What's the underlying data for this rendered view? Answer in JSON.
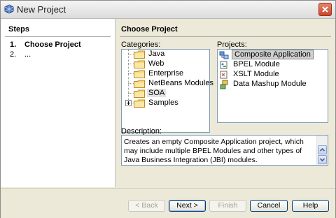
{
  "window": {
    "title": "New Project"
  },
  "steps": {
    "heading": "Steps",
    "items": [
      {
        "num": "1.",
        "label": "Choose Project"
      },
      {
        "num": "2.",
        "label": "..."
      }
    ]
  },
  "panel": {
    "heading": "Choose Project",
    "categories_label": "Categories:",
    "projects_label": "Projects:",
    "categories": [
      "Java",
      "Web",
      "Enterprise",
      "NetBeans Modules",
      "SOA",
      "Samples"
    ],
    "selected_category": "SOA",
    "projects": [
      {
        "label": "Composite Application",
        "icon": "composite-app-icon"
      },
      {
        "label": "BPEL Module",
        "icon": "bpel-module-icon"
      },
      {
        "label": "XSLT Module",
        "icon": "xslt-module-icon"
      },
      {
        "label": "Data Mashup Module",
        "icon": "data-mashup-icon"
      }
    ],
    "selected_project": "Composite Application",
    "description_label": "Description:",
    "description": "Creates an empty Composite Application project, which may include multiple BPEL Modules and other types of Java Business Integration (JBI) modules."
  },
  "buttons": {
    "back": "< Back",
    "next": "Next >",
    "finish": "Finish",
    "cancel": "Cancel",
    "help": "Help"
  },
  "colors": {
    "accent": "#003c74",
    "selection": "#cfcfcf"
  }
}
